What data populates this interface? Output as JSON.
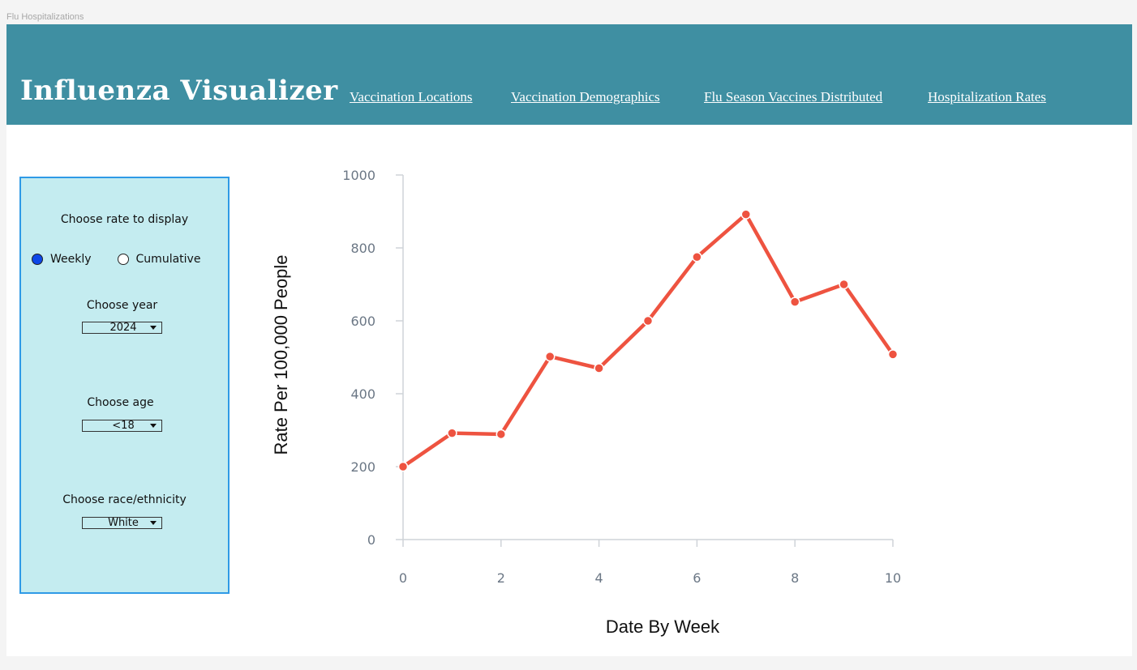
{
  "page_tab_label": "Flu Hospitalizations",
  "header": {
    "brand": "Influenza Visualizer",
    "nav": [
      "Vaccination Locations",
      "Vaccination Demographics",
      "Flu Season Vaccines Distributed",
      "Hospitalization Rates"
    ],
    "bg_color": "#3f8fa2"
  },
  "controls": {
    "rate_heading": "Choose rate to display",
    "rate_options": [
      "Weekly",
      "Cumulative"
    ],
    "rate_selected": "Weekly",
    "year_heading": "Choose year",
    "year_value": "2024",
    "age_heading": "Choose age",
    "age_value": "<18",
    "race_heading": "Choose race/ethnicity",
    "race_value": "White",
    "panel_color": "#c4ecf0",
    "border_color": "#2f9ae6"
  },
  "chart_data": {
    "type": "line",
    "x": [
      0,
      1,
      2,
      3,
      4,
      5,
      6,
      7,
      8,
      9,
      10
    ],
    "series": [
      {
        "values": [
          200,
          292,
          289,
          502,
          470,
          600,
          775,
          892,
          652,
          700,
          508
        ],
        "color": "#ee5340"
      }
    ],
    "xlabel": "Date By Week",
    "ylabel": "Rate Per 100,000 People",
    "xlim": [
      0,
      10
    ],
    "ylim": [
      0,
      1000
    ],
    "xticks": [
      0,
      2,
      4,
      6,
      8,
      10
    ],
    "yticks": [
      0,
      200,
      400,
      600,
      800,
      1000
    ],
    "grid": false
  }
}
